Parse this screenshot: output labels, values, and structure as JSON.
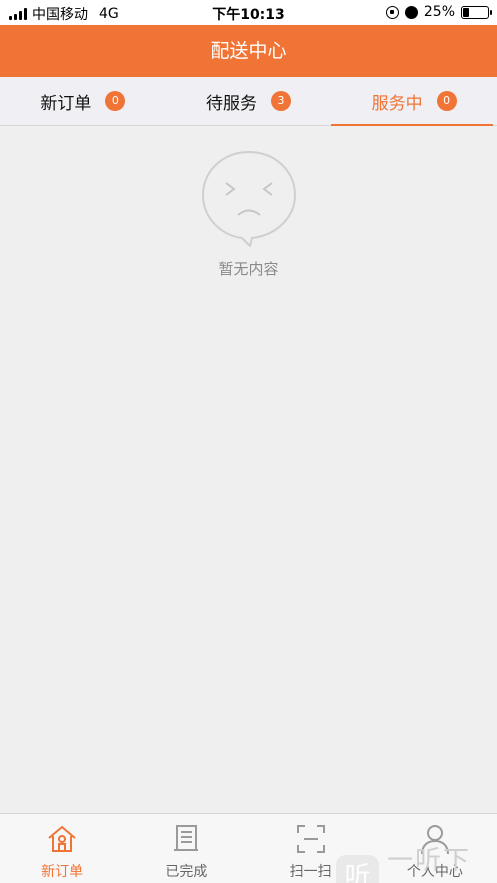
{
  "status_bar": {
    "carrier": "中国移动",
    "network": "4G",
    "time": "下午10:13",
    "battery_percent": "25%",
    "battery_level": 0.25
  },
  "header": {
    "title": "配送中心"
  },
  "tabs": [
    {
      "label": "新订单",
      "count": "0",
      "active": false
    },
    {
      "label": "待服务",
      "count": "3",
      "active": false
    },
    {
      "label": "服务中",
      "count": "0",
      "active": true
    }
  ],
  "empty_state": {
    "text": "暂无内容",
    "icon": "sad-face-icon"
  },
  "bottom_nav": [
    {
      "label": "新订单",
      "icon": "home-icon",
      "active": true
    },
    {
      "label": "已完成",
      "icon": "document-icon",
      "active": false
    },
    {
      "label": "扫一扫",
      "icon": "scan-icon",
      "active": false
    },
    {
      "label": "个人中心",
      "icon": "person-icon",
      "active": false
    }
  ],
  "watermark": {
    "badge": "听",
    "text": "一听下载"
  },
  "colors": {
    "accent": "#f07436",
    "background": "#efefef"
  }
}
